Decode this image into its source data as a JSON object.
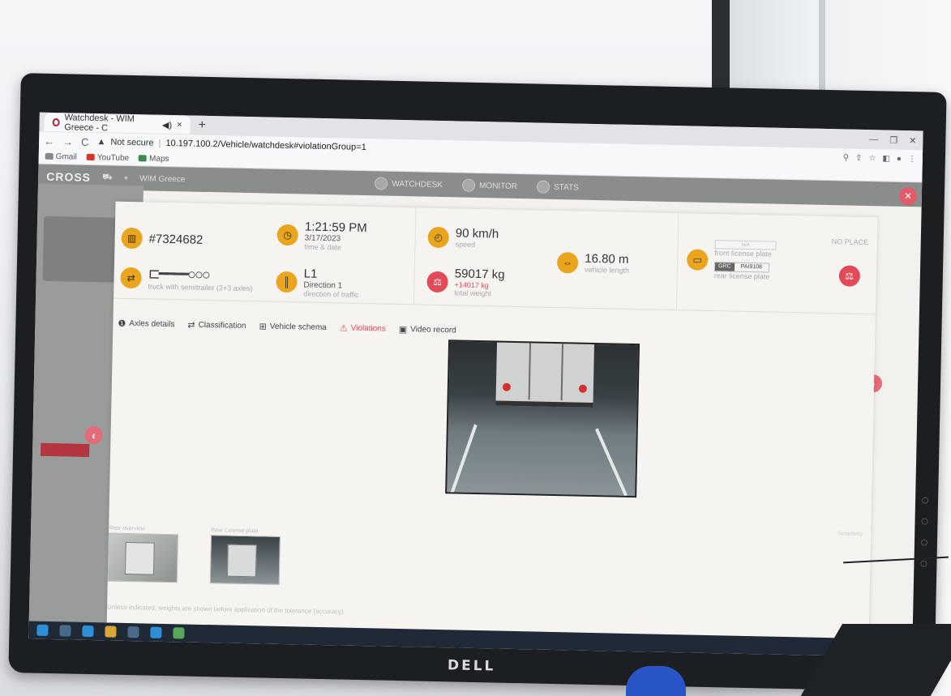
{
  "browser": {
    "tab_title": "Watchdesk - WIM Greece - C",
    "new_tab": "+",
    "close_tab": "×",
    "security_label": "Not secure",
    "url": "10.197.100.2/Vehicle/watchdesk#violationGroup=1",
    "bookmarks": [
      "Gmail",
      "YouTube",
      "Maps"
    ]
  },
  "app": {
    "logo": "CROSS",
    "site": "WIM Greece",
    "nav": [
      "WATCHDESK",
      "MONITOR",
      "STATS"
    ]
  },
  "vehicle": {
    "id": "#7324682",
    "time": "1:21:59 PM",
    "date": "3/17/2023",
    "time_label": "time & date",
    "speed": "90 km/h",
    "speed_label": "speed",
    "length": "16.80 m",
    "length_label": "vehicle length",
    "front_plate_label": "front license plate",
    "front_plate_value": "N/A",
    "rear_country": "GRC",
    "rear_plate": "PAI9108",
    "rear_plate_label": "rear license plate",
    "no_place": "NO PLACE",
    "class_desc": "truck with semitrailer (2+3 axles)",
    "lane": "L1",
    "direction": "Direction 1",
    "direction_label": "direction of traffic",
    "weight": "59017 kg",
    "overweight": "+14017 kg",
    "weight_label": "total weight"
  },
  "tabs": [
    "Axles details",
    "Classification",
    "Vehicle schema",
    "Violations",
    "Video record"
  ],
  "thumbs": [
    "Rear overview",
    "Rear License plate"
  ],
  "footnote": "Unless indicated, weights are shown before application of the tolerance (accuracy)",
  "side_note": "Sensitivity",
  "monitor_brand": "DELL"
}
